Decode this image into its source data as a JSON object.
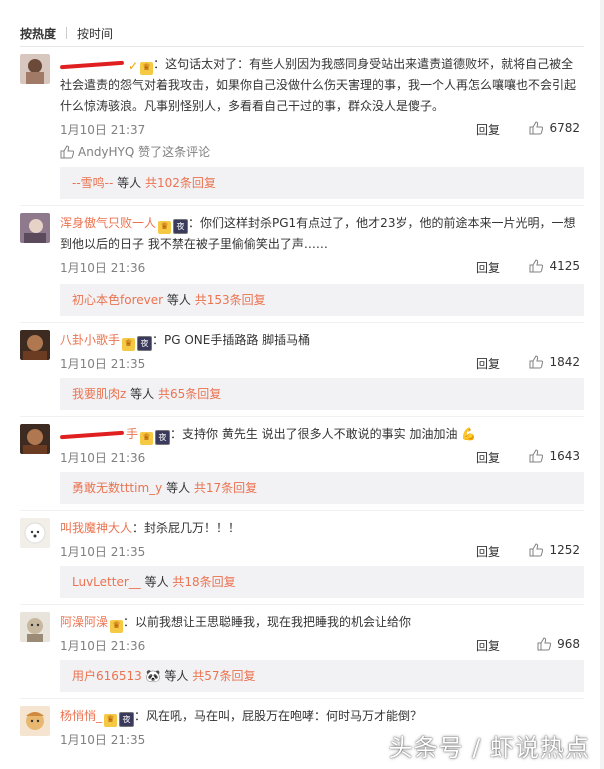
{
  "tabs": [
    "按热度",
    "按时间"
  ],
  "comments": [
    {
      "user": "",
      "text": "：这句话太对了：有些人别因为我感同身受站出来遣责道德败坏，就将自己被全社会遣责的怨气对着我攻击，如果你自己没做什么伤天害理的事，我一个人再怎么嚷嚷也不会引起什么惊涛骇浪。凡事别怪别人，多看看自己干过的事，群众没人是傻子。",
      "time": "1月10日 21:37",
      "reply": "回复",
      "likes": "6782",
      "liked_by": "AndyHYQ 赞了这条评论",
      "sub_user": "--雪鸣--",
      "sub_mid": " 等人 ",
      "sub_count": "共102条回复"
    },
    {
      "user": "浑身傲气只败一人",
      "text": "：你们这样封杀PG1有点过了，他才23岁，他的前途本来一片光明，一想到他以后的日子 我不禁在被子里偷偷笑出了声……",
      "time": "1月10日 21:36",
      "reply": "回复",
      "likes": "4125",
      "sub_user": "初心本色forever",
      "sub_mid": " 等人 ",
      "sub_count": "共153条回复"
    },
    {
      "user": "八卦小歌手",
      "text": "：PG ONE手插路路 脚插马桶",
      "time": "1月10日 21:35",
      "reply": "回复",
      "likes": "1842",
      "sub_user": "我要肌肉z",
      "sub_mid": " 等人 ",
      "sub_count": "共65条回复"
    },
    {
      "user": "手",
      "text": "：支持你 黄先生 说出了很多人不敢说的事实 加油加油 💪",
      "time": "1月10日 21:36",
      "reply": "回复",
      "likes": "1643",
      "sub_user": "勇敢无数tttim_y",
      "sub_mid": " 等人 ",
      "sub_count": "共17条回复"
    },
    {
      "user": "叫我魔神大人",
      "text": "：封杀屁几万！！！",
      "time": "1月10日 21:35",
      "reply": "回复",
      "likes": "1252",
      "sub_user": "LuvLetter__",
      "sub_mid": " 等人 ",
      "sub_count": "共18条回复"
    },
    {
      "user": "阿澡阿澡",
      "text": "：以前我想让王思聪睡我，现在我把睡我的机会让给你",
      "time": "1月10日 21:36",
      "reply": "回复",
      "likes": "968",
      "sub_user": "用户616513 🐼",
      "sub_mid": " 等人 ",
      "sub_count": "共57条回复"
    },
    {
      "user": "杨悄悄_",
      "text": "：风在吼，马在叫，屁股万在咆哮：何时马万才能倒？",
      "time": "1月10日 21:35",
      "reply": "回复",
      "likes": "",
      "sub_user": "",
      "sub_mid": "",
      "sub_count": ""
    }
  ],
  "watermark": "头条号 / 虾说热点",
  "colors": {
    "username": "#eb7350",
    "reply_bg": "#f2f2f5",
    "meta": "#808080"
  }
}
